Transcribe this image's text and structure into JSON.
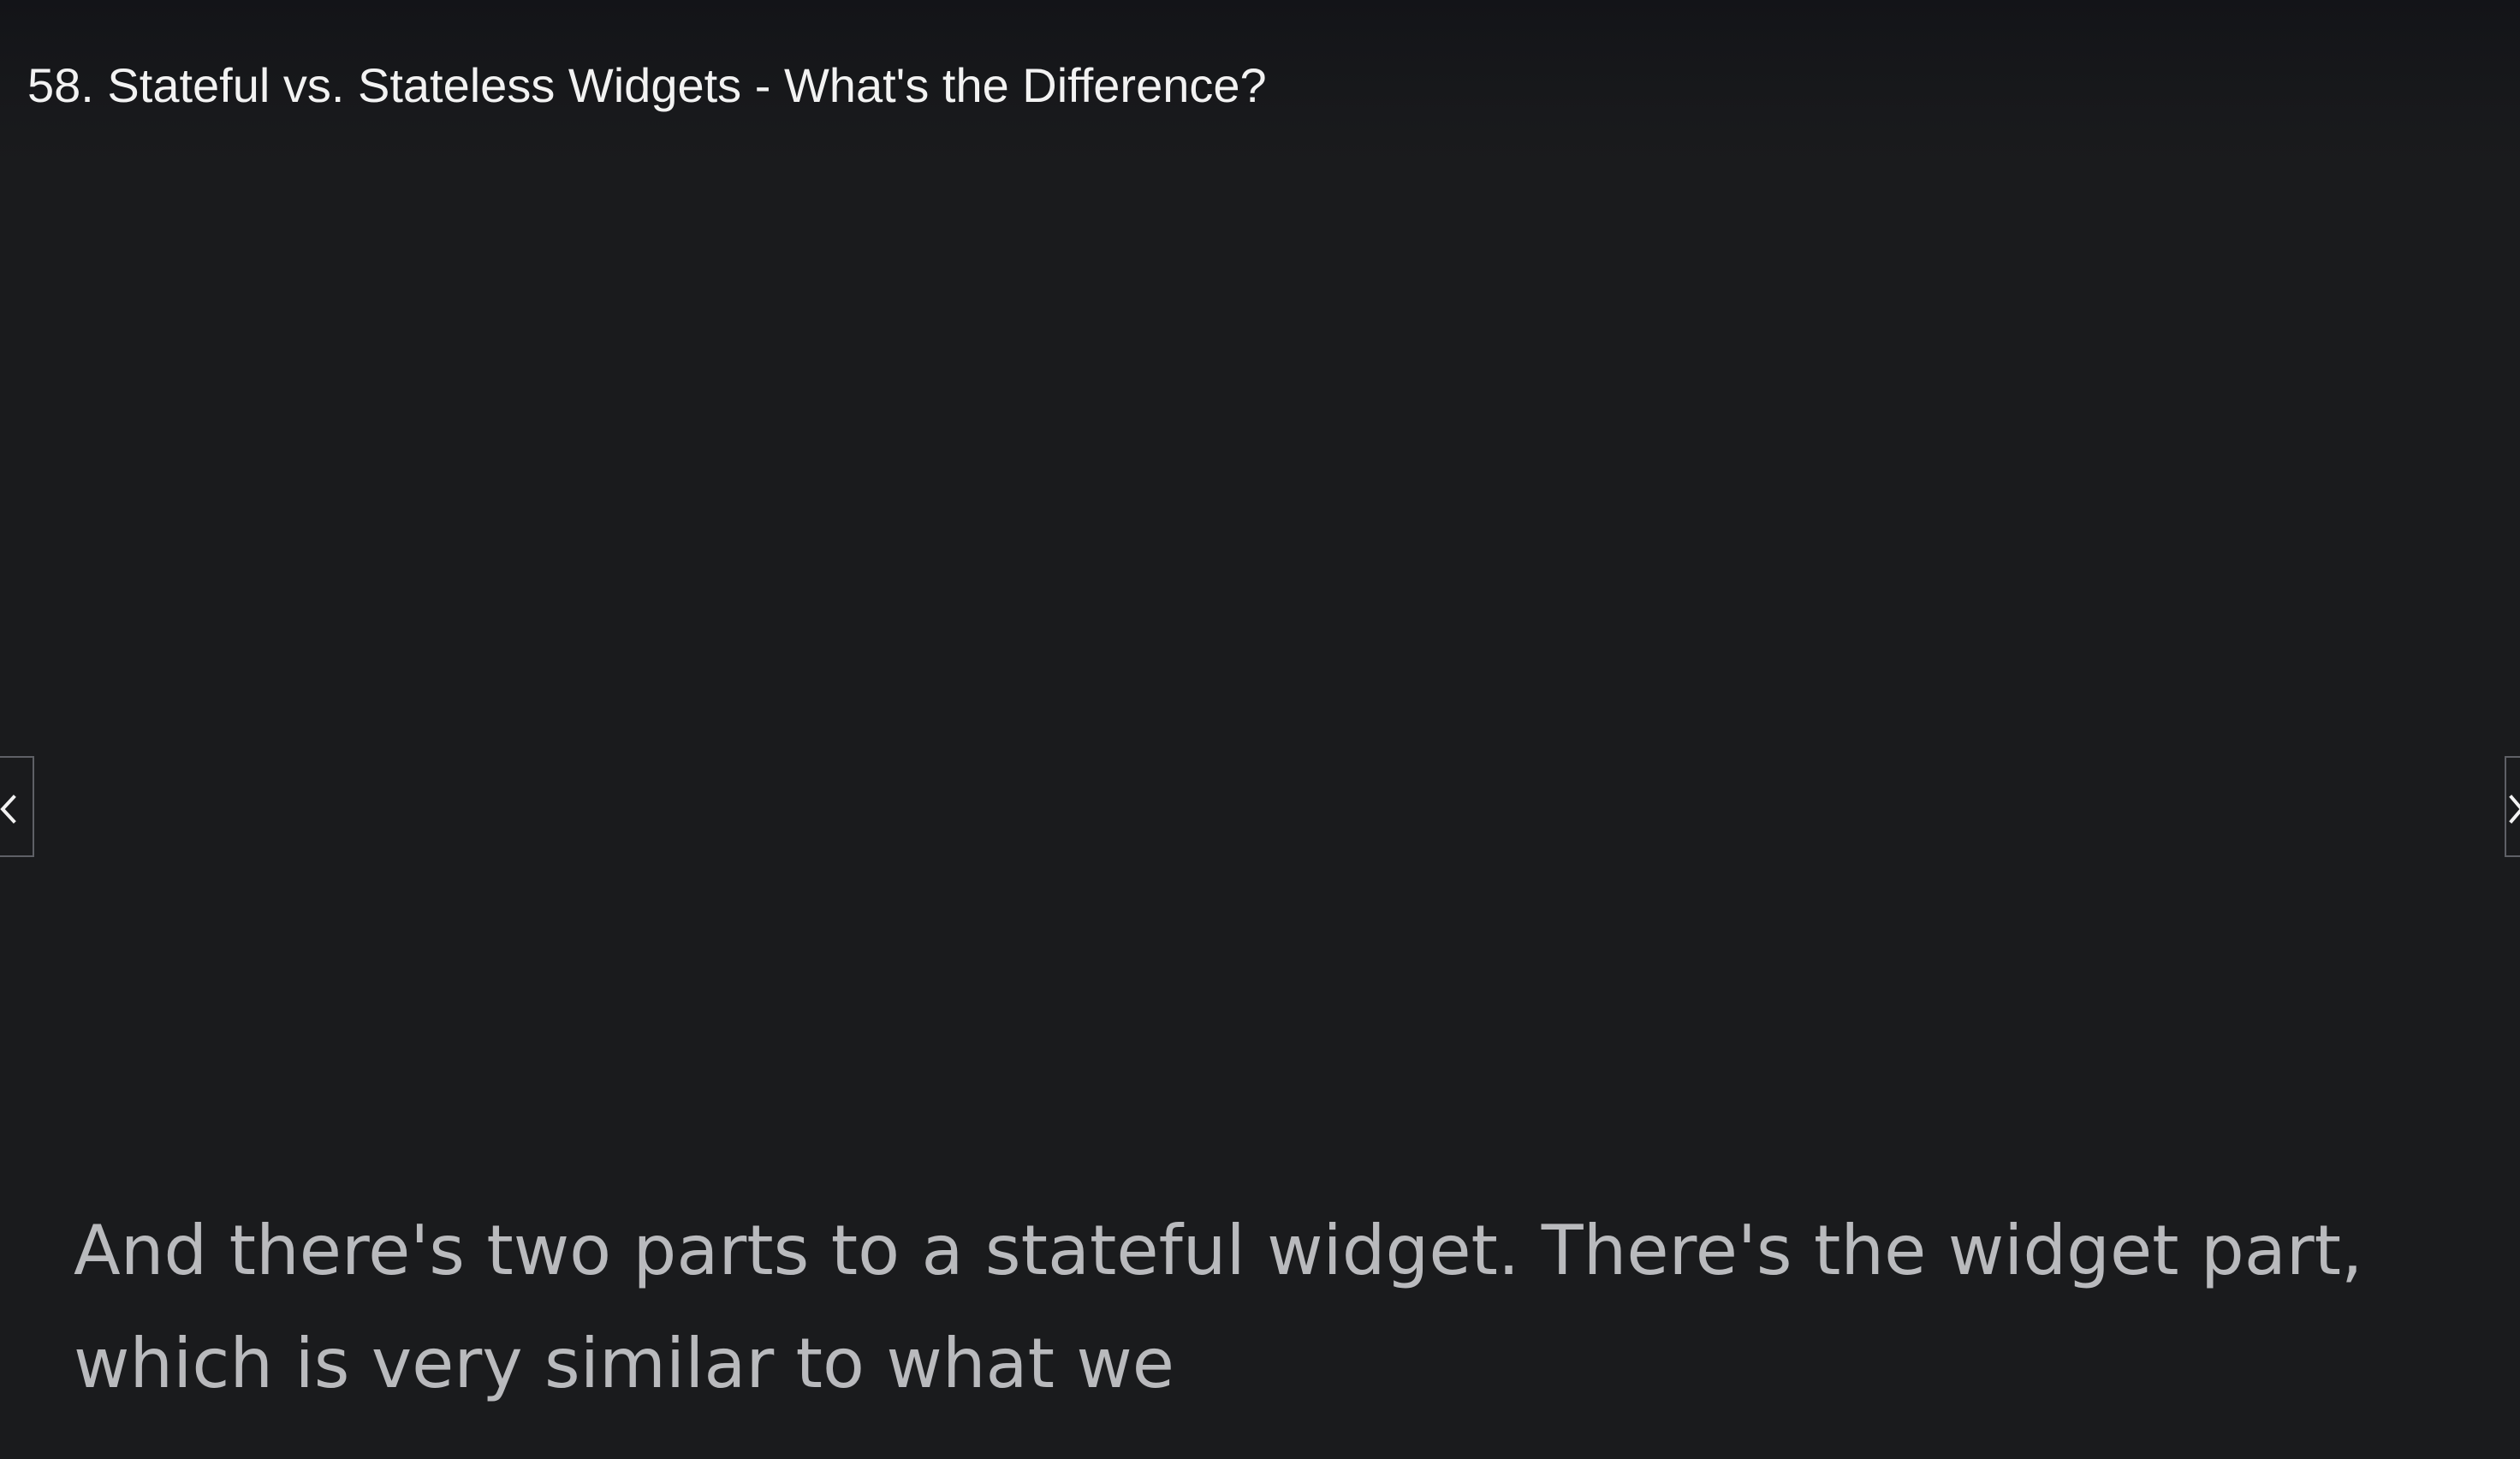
{
  "lecture": {
    "title": "58. Stateful vs. Stateless Widgets - What's the Difference?"
  },
  "navigation": {
    "prev_icon": "chevron-left-icon",
    "next_icon": "chevron-right-icon"
  },
  "caption": {
    "line1": "And there's two parts to a stateful widget. There's the widget part,",
    "line2": "which is very similar to what we"
  },
  "colors": {
    "background": "#1a1b1d",
    "title_text": "#f2f2f2",
    "caption_text": "#b9babd",
    "nav_border": "#5e6066"
  }
}
